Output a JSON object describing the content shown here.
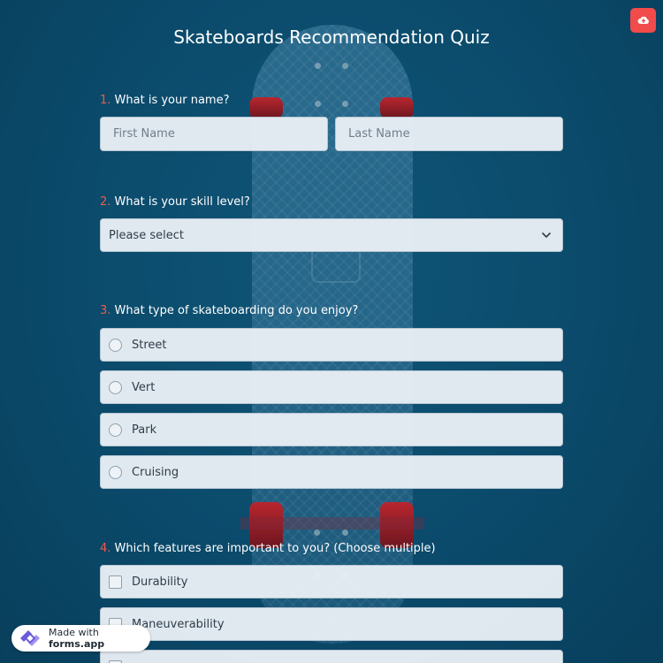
{
  "title": "Skateboards Recommendation Quiz",
  "questions": [
    {
      "number": "1.",
      "text": "What is your name?"
    },
    {
      "number": "2.",
      "text": "What is your skill level?"
    },
    {
      "number": "3.",
      "text": "What type of skateboarding do you enjoy?"
    },
    {
      "number": "4.",
      "text": "Which features are important to you? (Choose multiple)"
    }
  ],
  "name_fields": {
    "first_placeholder": "First Name",
    "last_placeholder": "Last Name"
  },
  "skill_select": {
    "value": "Please select"
  },
  "skate_types": [
    "Street",
    "Vert",
    "Park",
    "Cruising"
  ],
  "features": [
    "Durability",
    "Maneuverability"
  ],
  "footer_badge": {
    "prefix": "Made with ",
    "brand": "forms.app"
  },
  "colors": {
    "accent": "#f14b4b",
    "background": "#0b4a6b",
    "question_number": "#ef5a4a"
  },
  "icons": {
    "upload": "cloud-upload-icon",
    "dropdown": "chevron-down-icon",
    "brand": "forms-app-logo-icon"
  }
}
